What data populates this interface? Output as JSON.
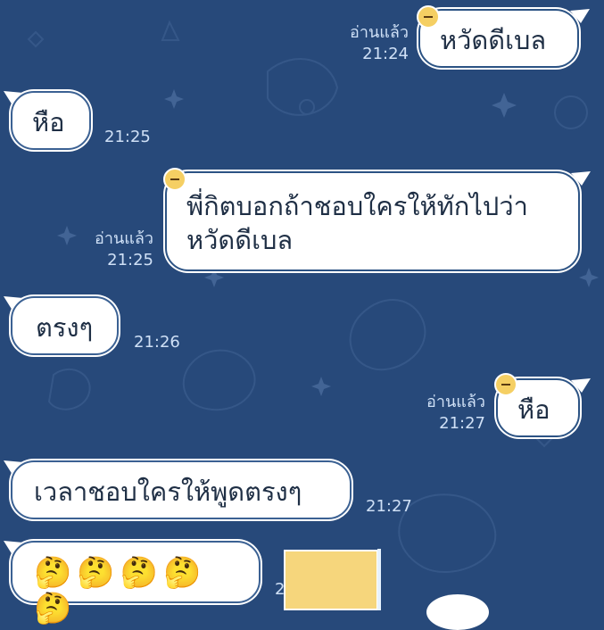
{
  "chat": {
    "messages": [
      {
        "side": "right",
        "text": "หวัดดีเบล",
        "time": "21:24",
        "read": "อ่านแล้ว"
      },
      {
        "side": "left",
        "text": "หือ",
        "time": "21:25"
      },
      {
        "side": "right",
        "text": "พี่กิตบอกถ้าชอบใครให้ทักไปว่า\nหวัดดีเบล",
        "time": "21:25",
        "read": "อ่านแล้ว"
      },
      {
        "side": "left",
        "text": "ตรงๆ",
        "time": "21:26"
      },
      {
        "side": "right",
        "text": "หือ",
        "time": "21:27",
        "read": "อ่านแล้ว"
      },
      {
        "side": "left",
        "text": "เวลาชอบใครให้พูดตรงๆ",
        "time": "21:27"
      },
      {
        "side": "left",
        "emojis": [
          "🤔",
          "🤔",
          "🤔",
          "🤔",
          "🤔"
        ],
        "time": "21:27"
      }
    ]
  },
  "theme": {
    "background": "#27497a",
    "bubble": "#ffffff",
    "text": "#1f2f45",
    "meta": "#cfe0f6"
  },
  "icons": [
    "avatar-icon",
    "sticker-icon"
  ]
}
